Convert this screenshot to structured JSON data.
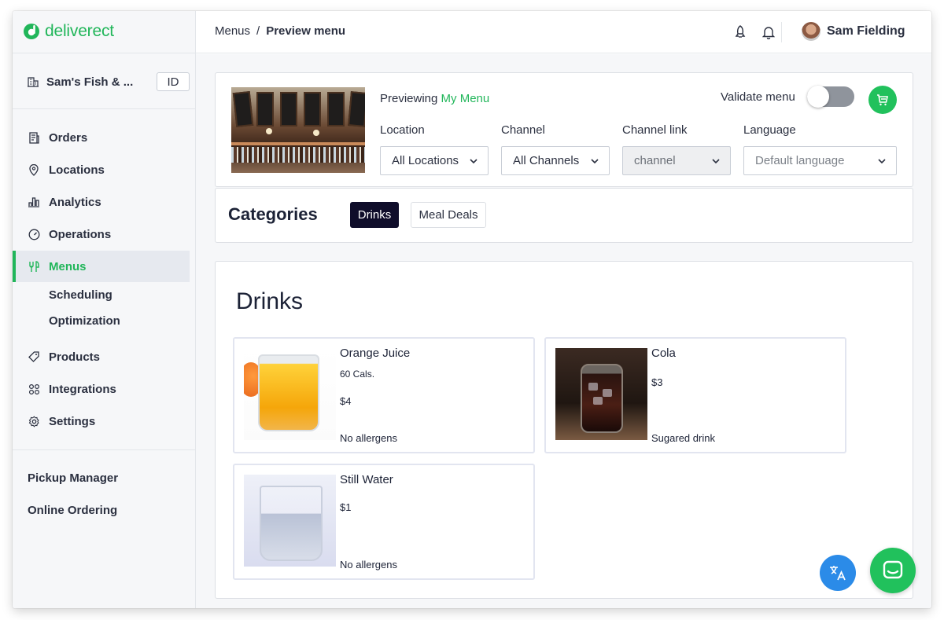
{
  "brand": {
    "name": "deliverect",
    "accent": "#21b65a"
  },
  "sidebar": {
    "store_name": "Sam's Fish & ...",
    "id_label": "ID",
    "items": [
      {
        "label": "Orders",
        "icon": "orders-icon"
      },
      {
        "label": "Locations",
        "icon": "location-pin-icon"
      },
      {
        "label": "Analytics",
        "icon": "bar-chart-icon"
      },
      {
        "label": "Operations",
        "icon": "gauge-icon"
      },
      {
        "label": "Menus",
        "icon": "fork-knife-icon",
        "active": true
      },
      {
        "label": "Products",
        "icon": "tag-icon"
      },
      {
        "label": "Integrations",
        "icon": "grid-icon"
      },
      {
        "label": "Settings",
        "icon": "gear-icon"
      }
    ],
    "sub_items": [
      "Scheduling",
      "Optimization"
    ],
    "bottom_items": [
      "Pickup Manager",
      "Online Ordering"
    ]
  },
  "header": {
    "breadcrumb_parent": "Menus",
    "breadcrumb_separator": "/",
    "breadcrumb_current": "Preview menu",
    "user_name": "Sam Fielding"
  },
  "preview": {
    "prefix": "Previewing",
    "menu_name": "My Menu",
    "validate_label": "Validate menu",
    "validate_on": false,
    "fields": [
      {
        "label": "Location",
        "value": "All Locations"
      },
      {
        "label": "Channel",
        "value": "All Channels"
      },
      {
        "label": "Channel link",
        "value": "channel"
      },
      {
        "label": "Language",
        "value": "Default language"
      }
    ]
  },
  "categories": {
    "title": "Categories",
    "items": [
      "Drinks",
      "Meal Deals"
    ],
    "selected": "Drinks"
  },
  "section": {
    "title": "Drinks",
    "products": [
      {
        "name": "Orange Juice",
        "calories": "60 Cals.",
        "price": "$4",
        "note": "No allergens"
      },
      {
        "name": "Cola",
        "price": "$3",
        "note": "Sugared drink"
      },
      {
        "name": "Still Water",
        "price": "$1",
        "note": "No allergens"
      }
    ]
  },
  "floating": {
    "translate_icon": "translate-icon",
    "chat_icon": "chat-icon"
  }
}
